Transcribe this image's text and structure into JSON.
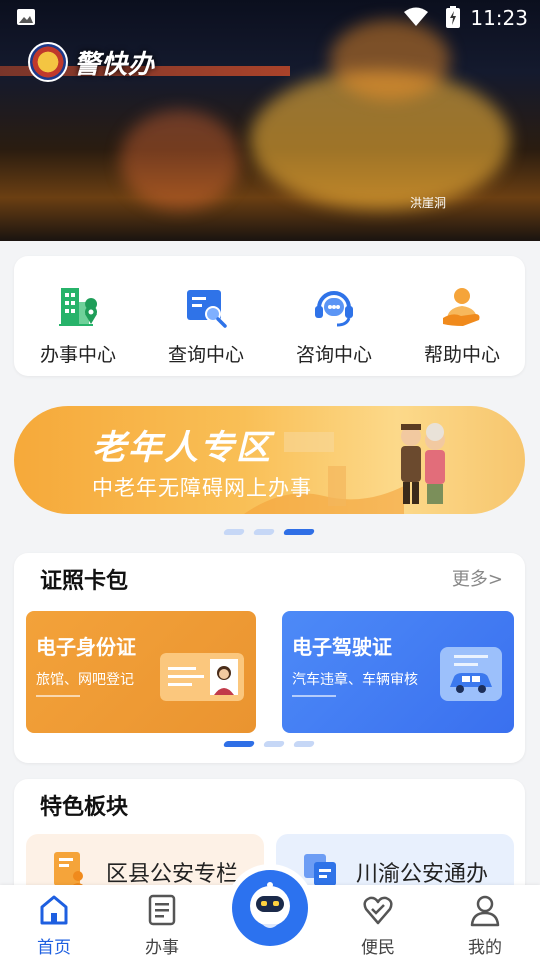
{
  "status": {
    "time": "11:23"
  },
  "hero": {
    "brand": "警快办",
    "caption": "洪崖洞"
  },
  "quick_actions": [
    {
      "label": "办事中心",
      "icon": "building-location-icon"
    },
    {
      "label": "查询中心",
      "icon": "search-document-icon"
    },
    {
      "label": "咨询中心",
      "icon": "headset-icon"
    },
    {
      "label": "帮助中心",
      "icon": "helping-hand-icon"
    }
  ],
  "elder_banner": {
    "title": "老年人专区",
    "subtitle": "中老年无障碍网上办事"
  },
  "wallet": {
    "title": "证照卡包",
    "more": "更多>",
    "cards": [
      {
        "title": "电子身份证",
        "desc": "旅馆、网吧登记",
        "color": "#f0a13a"
      },
      {
        "title": "电子驾驶证",
        "desc": "汽车违章、车辆审核",
        "color": "#3f7cf4"
      }
    ]
  },
  "special": {
    "title": "特色板块",
    "tiles": [
      {
        "label": "区县公安专栏",
        "icon": "document-person-icon"
      },
      {
        "label": "川渝公安通办",
        "icon": "copy-icon"
      }
    ]
  },
  "tabs": [
    {
      "label": "首页",
      "icon": "home-icon",
      "active": true
    },
    {
      "label": "办事",
      "icon": "list-document-icon"
    },
    {
      "label": "便民",
      "icon": "heart-icon"
    },
    {
      "label": "我的",
      "icon": "person-icon"
    }
  ],
  "colors": {
    "accent": "#1e5fe0",
    "quick_green": "#27b36a",
    "quick_blue": "#2f73e8",
    "orange": "#f5a43a"
  }
}
